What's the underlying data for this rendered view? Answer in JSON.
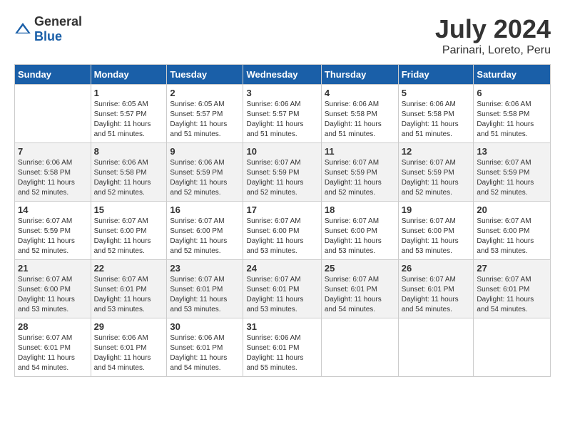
{
  "header": {
    "logo_general": "General",
    "logo_blue": "Blue",
    "month_title": "July 2024",
    "location": "Parinari, Loreto, Peru"
  },
  "calendar": {
    "days_of_week": [
      "Sunday",
      "Monday",
      "Tuesday",
      "Wednesday",
      "Thursday",
      "Friday",
      "Saturday"
    ],
    "weeks": [
      [
        {
          "day": "",
          "info": ""
        },
        {
          "day": "1",
          "info": "Sunrise: 6:05 AM\nSunset: 5:57 PM\nDaylight: 11 hours\nand 51 minutes."
        },
        {
          "day": "2",
          "info": "Sunrise: 6:05 AM\nSunset: 5:57 PM\nDaylight: 11 hours\nand 51 minutes."
        },
        {
          "day": "3",
          "info": "Sunrise: 6:06 AM\nSunset: 5:57 PM\nDaylight: 11 hours\nand 51 minutes."
        },
        {
          "day": "4",
          "info": "Sunrise: 6:06 AM\nSunset: 5:58 PM\nDaylight: 11 hours\nand 51 minutes."
        },
        {
          "day": "5",
          "info": "Sunrise: 6:06 AM\nSunset: 5:58 PM\nDaylight: 11 hours\nand 51 minutes."
        },
        {
          "day": "6",
          "info": "Sunrise: 6:06 AM\nSunset: 5:58 PM\nDaylight: 11 hours\nand 51 minutes."
        }
      ],
      [
        {
          "day": "7",
          "info": "Sunrise: 6:06 AM\nSunset: 5:58 PM\nDaylight: 11 hours\nand 52 minutes."
        },
        {
          "day": "8",
          "info": "Sunrise: 6:06 AM\nSunset: 5:58 PM\nDaylight: 11 hours\nand 52 minutes."
        },
        {
          "day": "9",
          "info": "Sunrise: 6:06 AM\nSunset: 5:59 PM\nDaylight: 11 hours\nand 52 minutes."
        },
        {
          "day": "10",
          "info": "Sunrise: 6:07 AM\nSunset: 5:59 PM\nDaylight: 11 hours\nand 52 minutes."
        },
        {
          "day": "11",
          "info": "Sunrise: 6:07 AM\nSunset: 5:59 PM\nDaylight: 11 hours\nand 52 minutes."
        },
        {
          "day": "12",
          "info": "Sunrise: 6:07 AM\nSunset: 5:59 PM\nDaylight: 11 hours\nand 52 minutes."
        },
        {
          "day": "13",
          "info": "Sunrise: 6:07 AM\nSunset: 5:59 PM\nDaylight: 11 hours\nand 52 minutes."
        }
      ],
      [
        {
          "day": "14",
          "info": "Sunrise: 6:07 AM\nSunset: 5:59 PM\nDaylight: 11 hours\nand 52 minutes."
        },
        {
          "day": "15",
          "info": "Sunrise: 6:07 AM\nSunset: 6:00 PM\nDaylight: 11 hours\nand 52 minutes."
        },
        {
          "day": "16",
          "info": "Sunrise: 6:07 AM\nSunset: 6:00 PM\nDaylight: 11 hours\nand 52 minutes."
        },
        {
          "day": "17",
          "info": "Sunrise: 6:07 AM\nSunset: 6:00 PM\nDaylight: 11 hours\nand 53 minutes."
        },
        {
          "day": "18",
          "info": "Sunrise: 6:07 AM\nSunset: 6:00 PM\nDaylight: 11 hours\nand 53 minutes."
        },
        {
          "day": "19",
          "info": "Sunrise: 6:07 AM\nSunset: 6:00 PM\nDaylight: 11 hours\nand 53 minutes."
        },
        {
          "day": "20",
          "info": "Sunrise: 6:07 AM\nSunset: 6:00 PM\nDaylight: 11 hours\nand 53 minutes."
        }
      ],
      [
        {
          "day": "21",
          "info": "Sunrise: 6:07 AM\nSunset: 6:00 PM\nDaylight: 11 hours\nand 53 minutes."
        },
        {
          "day": "22",
          "info": "Sunrise: 6:07 AM\nSunset: 6:01 PM\nDaylight: 11 hours\nand 53 minutes."
        },
        {
          "day": "23",
          "info": "Sunrise: 6:07 AM\nSunset: 6:01 PM\nDaylight: 11 hours\nand 53 minutes."
        },
        {
          "day": "24",
          "info": "Sunrise: 6:07 AM\nSunset: 6:01 PM\nDaylight: 11 hours\nand 53 minutes."
        },
        {
          "day": "25",
          "info": "Sunrise: 6:07 AM\nSunset: 6:01 PM\nDaylight: 11 hours\nand 54 minutes."
        },
        {
          "day": "26",
          "info": "Sunrise: 6:07 AM\nSunset: 6:01 PM\nDaylight: 11 hours\nand 54 minutes."
        },
        {
          "day": "27",
          "info": "Sunrise: 6:07 AM\nSunset: 6:01 PM\nDaylight: 11 hours\nand 54 minutes."
        }
      ],
      [
        {
          "day": "28",
          "info": "Sunrise: 6:07 AM\nSunset: 6:01 PM\nDaylight: 11 hours\nand 54 minutes."
        },
        {
          "day": "29",
          "info": "Sunrise: 6:06 AM\nSunset: 6:01 PM\nDaylight: 11 hours\nand 54 minutes."
        },
        {
          "day": "30",
          "info": "Sunrise: 6:06 AM\nSunset: 6:01 PM\nDaylight: 11 hours\nand 54 minutes."
        },
        {
          "day": "31",
          "info": "Sunrise: 6:06 AM\nSunset: 6:01 PM\nDaylight: 11 hours\nand 55 minutes."
        },
        {
          "day": "",
          "info": ""
        },
        {
          "day": "",
          "info": ""
        },
        {
          "day": "",
          "info": ""
        }
      ]
    ]
  }
}
